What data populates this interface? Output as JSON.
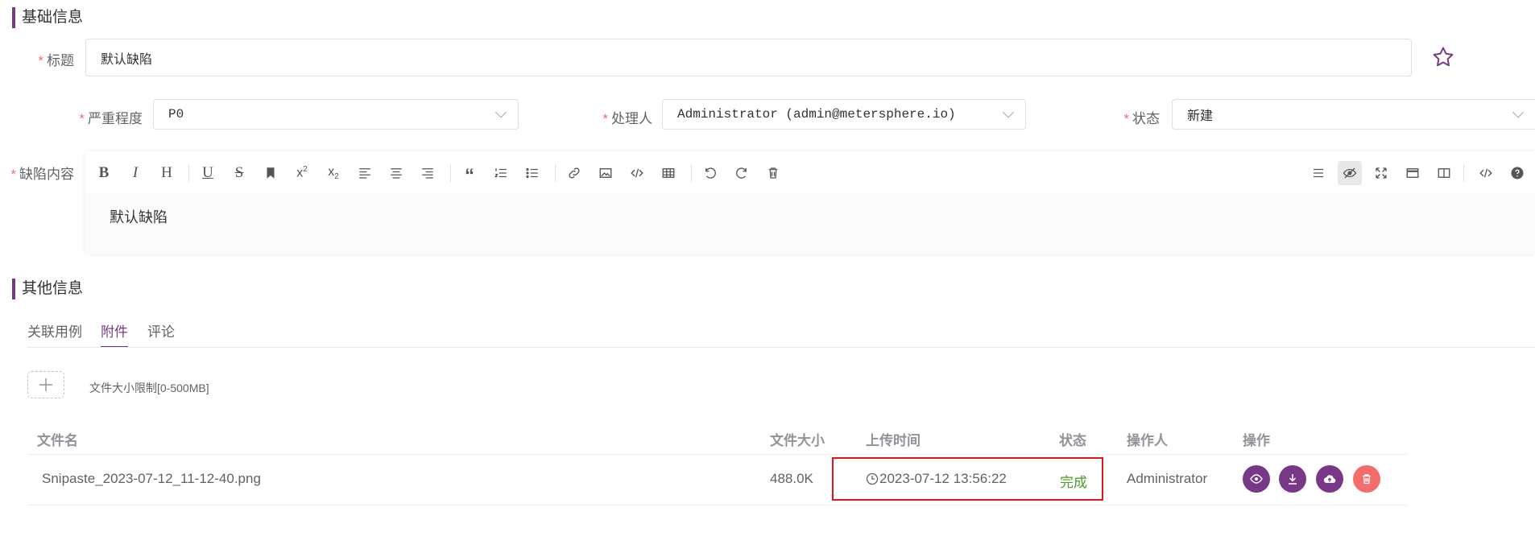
{
  "basic_section": {
    "title": "基础信息"
  },
  "title_field": {
    "label": "标题",
    "value": "默认缺陷"
  },
  "severity_field": {
    "label": "严重程度",
    "value": "P0"
  },
  "assignee_field": {
    "label": "处理人",
    "value": "Administrator (admin@metersphere.io)"
  },
  "status_field": {
    "label": "状态",
    "value": "新建"
  },
  "content_field": {
    "label": "缺陷内容",
    "value": "默认缺陷"
  },
  "toolbar": {
    "left": [
      "bold-icon",
      "italic-icon",
      "header-icon",
      "underline-icon",
      "strikethrough-icon",
      "bookmark-icon",
      "superscript-icon",
      "subscript-icon",
      "align-left-icon",
      "align-center-icon",
      "align-right-icon",
      "quote-icon",
      "ordered-list-icon",
      "unordered-list-icon",
      "link-icon",
      "image-icon",
      "code-icon",
      "table-icon",
      "undo-icon",
      "redo-icon",
      "trash-icon"
    ],
    "right": [
      "navigation-icon",
      "preview-icon",
      "fullscreen-icon",
      "subfield-icon",
      "split-icon",
      "html-code-icon",
      "help-icon"
    ]
  },
  "other_section": {
    "title": "其他信息"
  },
  "tabs": [
    {
      "label": "关联用例"
    },
    {
      "label": "附件"
    },
    {
      "label": "评论"
    }
  ],
  "upload": {
    "hint": "文件大小限制[0-500MB]"
  },
  "table": {
    "headers": {
      "name": "文件名",
      "size": "文件大小",
      "time": "上传时间",
      "status": "状态",
      "operator": "操作人",
      "actions": "操作"
    },
    "rows": [
      {
        "name": "Snipaste_2023-07-12_11-12-40.png",
        "size": "488.0K",
        "time": "2023-07-12 13:56:22",
        "status": "完成",
        "operator": "Administrator"
      }
    ]
  },
  "colors": {
    "accent": "#783887",
    "required": "#f56c6c",
    "success": "#4c9a2a",
    "danger": "#f56c6c",
    "highlight": "#e0161b"
  }
}
